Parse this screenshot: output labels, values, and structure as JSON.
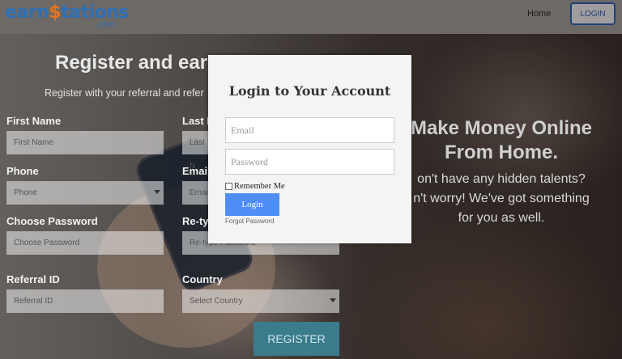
{
  "header": {
    "logo_text_main": "earn",
    "logo_text_dollar": "$",
    "logo_text_rest": "tations",
    "logo_sub": ".com",
    "nav_home": "Home",
    "nav_login": "LOGIN"
  },
  "register": {
    "title": "Register and ear",
    "subtitle": "Register with your referral and refer",
    "fields": {
      "first_name_label": "First Name",
      "first_name_placeholder": "First Name",
      "last_name_label": "Last N",
      "last_name_placeholder": "Last N",
      "phone_label": "Phone",
      "phone_placeholder": "Phone",
      "email_label": "Email",
      "email_placeholder": "Emai",
      "choose_password_label": "Choose Password",
      "choose_password_placeholder": "Choose Password",
      "retype_label": "Re-ty",
      "retype_placeholder": "Re-type Password",
      "referral_label": "Referral ID",
      "referral_placeholder": "Referral ID",
      "country_label": "Country",
      "country_value": "Select Country"
    },
    "register_button": "REGISTER"
  },
  "hero": {
    "heading_line1": "Make Money Online",
    "heading_line2": "From Home.",
    "text_line1": "on't have any hidden talents?",
    "text_line2": "n't worry! We've got something",
    "text_line3": "for you as well."
  },
  "modal": {
    "title": "Login to Your Account",
    "email_placeholder": "Email",
    "password_placeholder": "Password",
    "remember_label": "Remember Me",
    "remember_checked": false,
    "login_button": "Login",
    "forgot_link": "Forgot Password"
  },
  "colors": {
    "brand_blue": "#2f6fb5",
    "brand_orange": "#e8731b",
    "login_button": "#4f8ff5",
    "register_button": "#3a7c8c"
  }
}
